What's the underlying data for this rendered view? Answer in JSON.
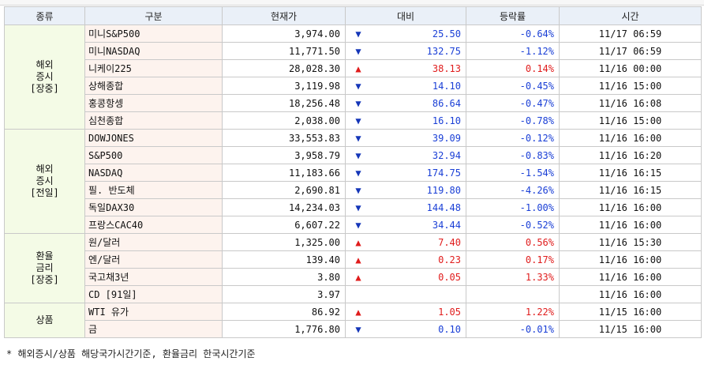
{
  "headers": {
    "type": "종류",
    "item": "구분",
    "price": "현재가",
    "change": "대비",
    "rate": "등락률",
    "time": "시간"
  },
  "groups": [
    {
      "label": "해외\n증시\n[장중]",
      "rows": [
        {
          "name": "미니S&P500",
          "price": "3,974.00",
          "dir": "down",
          "change": "25.50",
          "rate": "-0.64%",
          "time": "11/17 06:59"
        },
        {
          "name": "미니NASDAQ",
          "price": "11,771.50",
          "dir": "down",
          "change": "132.75",
          "rate": "-1.12%",
          "time": "11/17 06:59"
        },
        {
          "name": "니케이225",
          "price": "28,028.30",
          "dir": "up",
          "change": "38.13",
          "rate": "0.14%",
          "time": "11/16 00:00"
        },
        {
          "name": "상해종합",
          "price": "3,119.98",
          "dir": "down",
          "change": "14.10",
          "rate": "-0.45%",
          "time": "11/16 15:00"
        },
        {
          "name": "홍콩항셍",
          "price": "18,256.48",
          "dir": "down",
          "change": "86.64",
          "rate": "-0.47%",
          "time": "11/16 16:08"
        },
        {
          "name": "심천종합",
          "price": "2,038.00",
          "dir": "down",
          "change": "16.10",
          "rate": "-0.78%",
          "time": "11/16 15:00"
        }
      ]
    },
    {
      "label": "해외\n증시\n[전일]",
      "rows": [
        {
          "name": "DOWJONES",
          "price": "33,553.83",
          "dir": "down",
          "change": "39.09",
          "rate": "-0.12%",
          "time": "11/16 16:00"
        },
        {
          "name": "S&P500",
          "price": "3,958.79",
          "dir": "down",
          "change": "32.94",
          "rate": "-0.83%",
          "time": "11/16 16:20"
        },
        {
          "name": "NASDAQ",
          "price": "11,183.66",
          "dir": "down",
          "change": "174.75",
          "rate": "-1.54%",
          "time": "11/16 16:15"
        },
        {
          "name": "필. 반도체",
          "price": "2,690.81",
          "dir": "down",
          "change": "119.80",
          "rate": "-4.26%",
          "time": "11/16 16:15"
        },
        {
          "name": "독일DAX30",
          "price": "14,234.03",
          "dir": "down",
          "change": "144.48",
          "rate": "-1.00%",
          "time": "11/16 16:00"
        },
        {
          "name": "프랑스CAC40",
          "price": "6,607.22",
          "dir": "down",
          "change": "34.44",
          "rate": "-0.52%",
          "time": "11/16 16:00"
        }
      ]
    },
    {
      "label": "환율\n금리\n[장중]",
      "rows": [
        {
          "name": "원/달러",
          "price": "1,325.00",
          "dir": "up",
          "change": "7.40",
          "rate": "0.56%",
          "time": "11/16 15:30"
        },
        {
          "name": "엔/달러",
          "price": "139.40",
          "dir": "up",
          "change": "0.23",
          "rate": "0.17%",
          "time": "11/16 16:00"
        },
        {
          "name": "국고채3년",
          "price": "3.80",
          "dir": "up",
          "change": "0.05",
          "rate": "1.33%",
          "time": "11/16 16:00"
        },
        {
          "name": "CD [91일]",
          "price": "3.97",
          "dir": "none",
          "change": "",
          "rate": "",
          "time": "11/16 16:00"
        }
      ]
    },
    {
      "label": "상품",
      "rows": [
        {
          "name": "WTI 유가",
          "price": "86.92",
          "dir": "up",
          "change": "1.05",
          "rate": "1.22%",
          "time": "11/15 16:00"
        },
        {
          "name": "금",
          "price": "1,776.80",
          "dir": "down",
          "change": "0.10",
          "rate": "-0.01%",
          "time": "11/15 16:00"
        }
      ]
    }
  ],
  "arrows": {
    "up": "▲",
    "down": "▼"
  },
  "note": "* 해외증시/상품 해당국가시간기준, 환율금리 한국시간기준",
  "colors": {
    "up": "#e01c1c",
    "down": "#1a3fd6",
    "header_bg": "#eaf0f8",
    "category_bg": "#f4fbe6",
    "name_bg": "#fdf3ee"
  }
}
